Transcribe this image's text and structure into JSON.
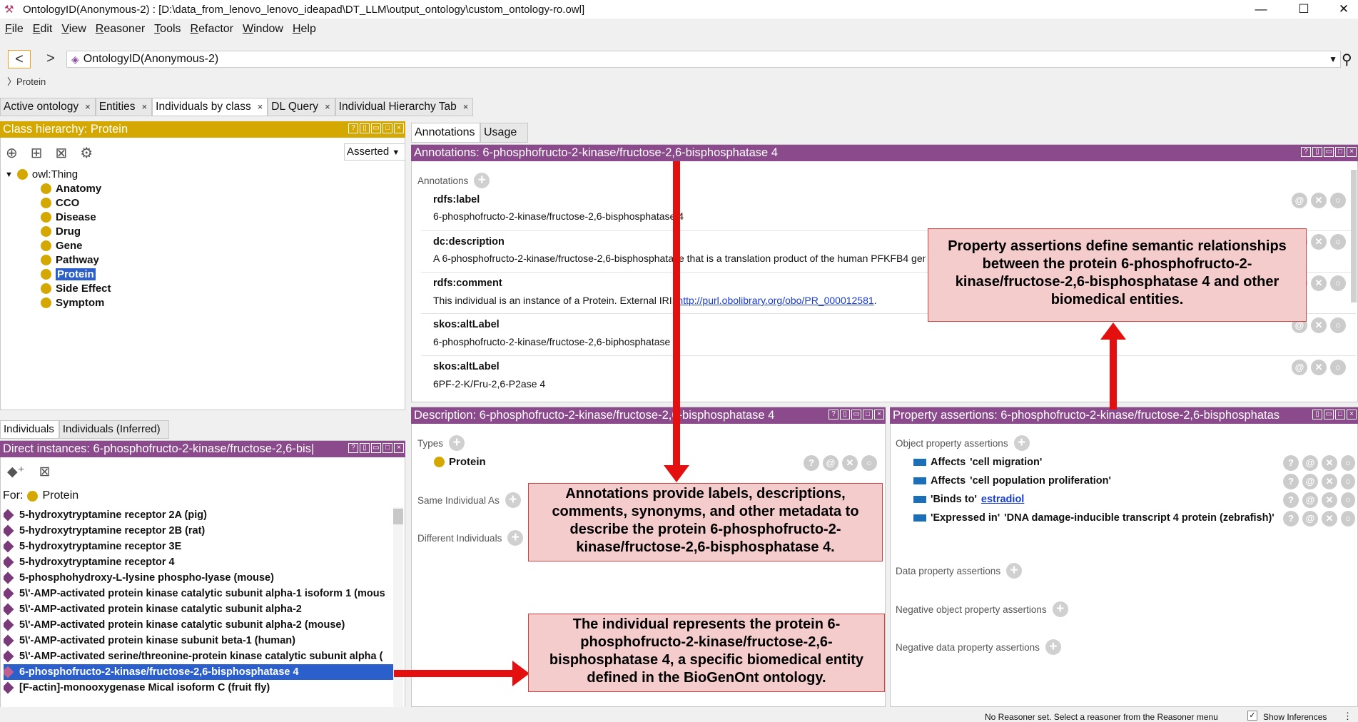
{
  "window": {
    "title": "OntologyID(Anonymous-2) : [D:\\data_from_lenovo_lenovo_ideapad\\DT_LLM\\output_ontology\\custom_ontology-ro.owl]",
    "minimize": "—",
    "maximize": "☐",
    "close": "✕"
  },
  "menu": [
    "File",
    "Edit",
    "View",
    "Reasoner",
    "Tools",
    "Refactor",
    "Window",
    "Help"
  ],
  "nav": {
    "back": "<",
    "forward": ">",
    "ontology": "OntologyID(Anonymous-2)",
    "breadcrumb": "Protein"
  },
  "tabs": [
    {
      "label": "Active ontology",
      "close": "×"
    },
    {
      "label": "Entities",
      "close": "×"
    },
    {
      "label": "Individuals by class",
      "close": "×"
    },
    {
      "label": "DL Query",
      "close": "×"
    },
    {
      "label": "Individual Hierarchy Tab",
      "close": "×"
    }
  ],
  "class_hierarchy": {
    "title": "Class hierarchy: Protein",
    "mode": "Asserted",
    "root": "owl:Thing",
    "items": [
      "Anatomy",
      "CCO",
      "Disease",
      "Drug",
      "Gene",
      "Pathway",
      "Protein",
      "Side Effect",
      "Symptom"
    ]
  },
  "individuals": {
    "tabs": [
      "Individuals",
      "Individuals (Inferred)"
    ],
    "title": "Direct instances: 6-phosphofructo-2-kinase/fructose-2,6-bis|",
    "for_label": "For:",
    "for_class": "Protein",
    "items": [
      "5-hydroxytryptamine receptor 2A (pig)",
      "5-hydroxytryptamine receptor 2B (rat)",
      "5-hydroxytryptamine receptor 3E",
      "5-hydroxytryptamine receptor 4",
      "5-phosphohydroxy-L-lysine phospho-lyase (mouse)",
      "5\\'-AMP-activated protein kinase catalytic subunit alpha-1 isoform 1 (mous",
      "5\\'-AMP-activated protein kinase catalytic subunit alpha-2",
      "5\\'-AMP-activated protein kinase catalytic subunit alpha-2 (mouse)",
      "5\\'-AMP-activated protein kinase subunit beta-1 (human)",
      "5\\'-AMP-activated serine/threonine-protein kinase catalytic subunit alpha (",
      "6-phosphofructo-2-kinase/fructose-2,6-bisphosphatase 4",
      "[F-actin]-monooxygenase Mical isoform C (fruit fly)"
    ]
  },
  "annotations": {
    "tabs": [
      "Annotations",
      "Usage"
    ],
    "title": "Annotations: 6-phosphofructo-2-kinase/fructose-2,6-bisphosphatase 4",
    "section": "Annotations",
    "rows": [
      {
        "prop": "rdfs:label",
        "value": "6-phosphofructo-2-kinase/fructose-2,6-bisphosphatase 4"
      },
      {
        "prop": "dc:description",
        "value": "A 6-phosphofructo-2-kinase/fructose-2,6-bisphosphatase that is a translation product of the human PFKFB4 gene."
      },
      {
        "prop": "rdfs:comment",
        "value": "This individual is an instance of a Protein. External IRI: ",
        "link": "http://purl.obolibrary.org/obo/PR_000012581",
        "tail": "."
      },
      {
        "prop": "skos:altLabel",
        "value": "6-phosphofructo-2-kinase/fructose-2,6-biphosphatase 4"
      },
      {
        "prop": "skos:altLabel",
        "value": "6PF-2-K/Fru-2,6-P2ase 4"
      }
    ]
  },
  "description": {
    "title": "Description: 6-phosphofructo-2-kinase/fructose-2,6-bisphosphatase 4",
    "types_label": "Types",
    "type": "Protein",
    "same_label": "Same Individual As",
    "different_label": "Different Individuals"
  },
  "property_assertions": {
    "title": "Property assertions: 6-phosphofructo-2-kinase/fructose-2,6-bisphosphatas",
    "object_label": "Object property assertions",
    "object_items": [
      {
        "prop": "Affects",
        "value": "'cell migration'"
      },
      {
        "prop": "Affects",
        "value": "'cell population proliferation'"
      },
      {
        "prop": "'Binds to'",
        "value": "estradiol",
        "link": true
      },
      {
        "prop": "'Expressed in'",
        "value": "'DNA damage-inducible transcript 4 protein (zebrafish)'"
      }
    ],
    "data_label": "Data property assertions",
    "neg_object_label": "Negative object property assertions",
    "neg_data_label": "Negative data property assertions"
  },
  "callouts": {
    "annotations": "Annotations provide labels, descriptions, comments, synonyms, and other metadata to describe the protein 6-phosphofructo-2-kinase/fructose-2,6-bisphosphatase 4.",
    "properties": "Property assertions define semantic relationships between the protein 6-phosphofructo-2-kinase/fructose-2,6-bisphosphatase 4 and other biomedical entities.",
    "individual": "The individual represents the protein 6-phosphofructo-2-kinase/fructose-2,6-bisphosphatase 4, a specific biomedical entity defined in the BioGenOnt ontology."
  },
  "status": {
    "message": "No Reasoner set. Select a reasoner from the Reasoner menu",
    "show_inferences": "Show Inferences"
  },
  "colors": {
    "class_header": "#d4a800",
    "individual_header": "#8b4a8b",
    "selection": "#2b5fcc",
    "arrow": "#e41010",
    "callout_bg": "#f5cccc"
  }
}
